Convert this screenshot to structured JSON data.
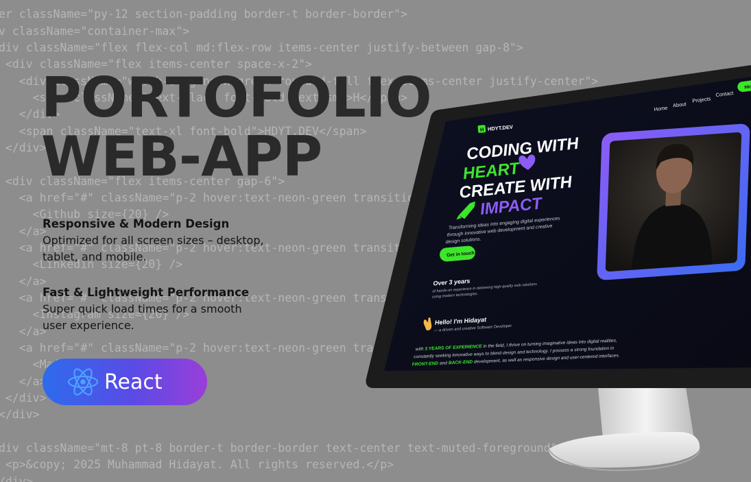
{
  "code_lines": [
    "er className=\"py-12 section-padding border-t border-border\">",
    "v className=\"container-max\">",
    "div className=\"flex flex-col md:flex-row items-center justify-between gap-8\">",
    " <div className=\"flex items-center space-x-2\">",
    "   <div className=\"w-8 h-8 bg-neon-green rounded-full flex items-center justify-center\">",
    "     <span className=\"text-black font-bold text-sm\">H</span>",
    "   </div>",
    "   <span className=\"text-xl font-bold\">HDYT.DEV</span>",
    " </div>",
    "",
    " <div className=\"flex items-center gap-6\">",
    "   <a href=\"#\" className=\"p-2 hover:text-neon-green transition-colors\">",
    "     <Github size={20} />",
    "   </a>",
    "   <a href=\"#\" className=\"p-2 hover:text-neon-green transition-colors\">",
    "     <Linkedin size={20} />",
    "   </a>",
    "   <a href=\"#\" className=\"p-2 hover:text-neon-green transition-colors\">",
    "     <Instagram size={20} />",
    "   </a>",
    "   <a href=\"#\" className=\"p-2 hover:text-neon-green transition-colors\">",
    "     <Mail size={20} />",
    "   </a>",
    " </div>",
    "</div>",
    "",
    "div className=\"mt-8 pt-8 border-t border-border text-center text-muted-foreground\">",
    " <p>&copy; 2025 Muhammad Hidayat. All rights reserved.</p>",
    "/div>"
  ],
  "headline": {
    "line1": "PORTOFOLIO",
    "line2": "WEB-APP"
  },
  "features": [
    {
      "title": "Responsive & Modern Design",
      "desc_line1": "Optimized for all screen sizes – desktop,",
      "desc_line2": "tablet, and mobile."
    },
    {
      "title": "Fast & Lightweight Performance",
      "desc_line1": "Super quick load times for a smooth",
      "desc_line2": "user experience."
    }
  ],
  "tech_badge": {
    "label": "React",
    "icon": "react-atom-icon"
  },
  "screen": {
    "nav": [
      "Home",
      "About",
      "Projects",
      "Contact"
    ],
    "nav_cta": "Hire",
    "logo_letter": "H",
    "logo_text": "HDYT.DEV",
    "hero_line1": "CODING WITH",
    "hero_line2": "HEART",
    "hero_line3": "CREATE WITH",
    "hero_line4": "IMPACT",
    "tagline_line1": "Transforming ideas into engaging digital experiences",
    "tagline_line2": "through innovative web development and creative",
    "tagline_line3": "design solutions.",
    "cta": "Get in touch",
    "exp_title": "Over 3 years",
    "exp_line1": "of hands-on experience in delivering high-quality web solutions",
    "exp_line2": "using modern technologies.",
    "intro_title": "Hello! I'm Hidayat",
    "intro_sub": "— a driven and creative Software Developer",
    "bio_line1_pre": "with ",
    "bio_line1_hl": "3 YEARS OF EXPERIENCE",
    "bio_line1_post": " in the field, I thrive on turning imaginative ideas into digital realities,",
    "bio_line2": "constantly seeking innovative ways to blend design and technology. I possess a strong foundation in",
    "bio_line3_hl1": "FRONT-END",
    "bio_line3_mid": " and ",
    "bio_line3_hl2": "BACK-END",
    "bio_line3_post": " development, as well as responsive design and user-centered interfaces."
  },
  "colors": {
    "background": "#8d8d8d",
    "neon_green": "#3de52b",
    "purple": "#8b5cf6",
    "screen_bg": "#0b0d1c",
    "pill_start": "#2d6bec",
    "pill_end": "#9a3ed9"
  }
}
